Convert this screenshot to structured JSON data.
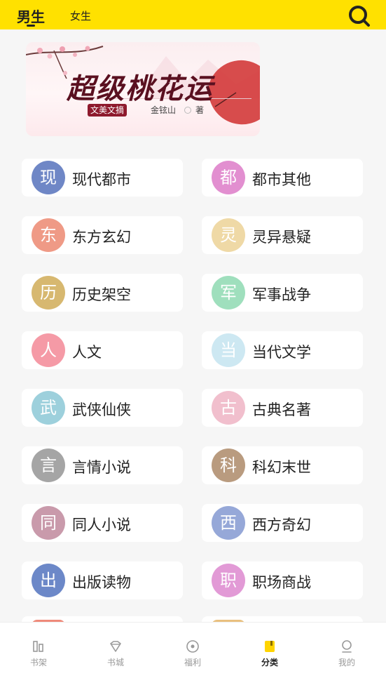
{
  "header": {
    "tab_male": "男生",
    "tab_female": "女生",
    "search_icon": "search-icon"
  },
  "banner": {
    "title": "超级桃花运",
    "seal_text": "文美文摘",
    "author": "金铉山",
    "author_suffix": "著"
  },
  "categories": [
    {
      "icon_char": "现",
      "label": "现代都市",
      "color": "#6f87c6"
    },
    {
      "icon_char": "都",
      "label": "都市其他",
      "color": "#e28fd0"
    },
    {
      "icon_char": "东",
      "label": "东方玄幻",
      "color": "#ef9a86"
    },
    {
      "icon_char": "灵",
      "label": "灵异悬疑",
      "color": "#efd9a6"
    },
    {
      "icon_char": "历",
      "label": "历史架空",
      "color": "#d7b870"
    },
    {
      "icon_char": "军",
      "label": "军事战争",
      "color": "#9fdfbd"
    },
    {
      "icon_char": "人",
      "label": "人文",
      "color": "#f59aa6"
    },
    {
      "icon_char": "当",
      "label": "当代文学",
      "color": "#cde8f2"
    },
    {
      "icon_char": "武",
      "label": "武侠仙侠",
      "color": "#9dd0dc"
    },
    {
      "icon_char": "古",
      "label": "古典名著",
      "color": "#f1bfcd"
    },
    {
      "icon_char": "言",
      "label": "言情小说",
      "color": "#a5a5a5"
    },
    {
      "icon_char": "科",
      "label": "科幻末世",
      "color": "#b99b7f"
    },
    {
      "icon_char": "同",
      "label": "同人小说",
      "color": "#c99aab"
    },
    {
      "icon_char": "西",
      "label": "西方奇幻",
      "color": "#96a8d8"
    },
    {
      "icon_char": "出",
      "label": "出版读物",
      "color": "#6c88c8"
    },
    {
      "icon_char": "职",
      "label": "职场商战",
      "color": "#e29ad6"
    }
  ],
  "peek_colors": [
    "#ef8a7a",
    "#e9c07f"
  ],
  "bottom_nav": [
    {
      "label": "书架",
      "icon": "bookshelf-icon",
      "active": false
    },
    {
      "label": "书城",
      "icon": "bookstore-diamond-icon",
      "active": false
    },
    {
      "label": "福利",
      "icon": "welfare-icon",
      "active": false
    },
    {
      "label": "分类",
      "icon": "category-book-icon",
      "active": true
    },
    {
      "label": "我的",
      "icon": "profile-icon",
      "active": false
    }
  ],
  "colors": {
    "accent": "#ffe100",
    "background": "#f6f6f6"
  }
}
